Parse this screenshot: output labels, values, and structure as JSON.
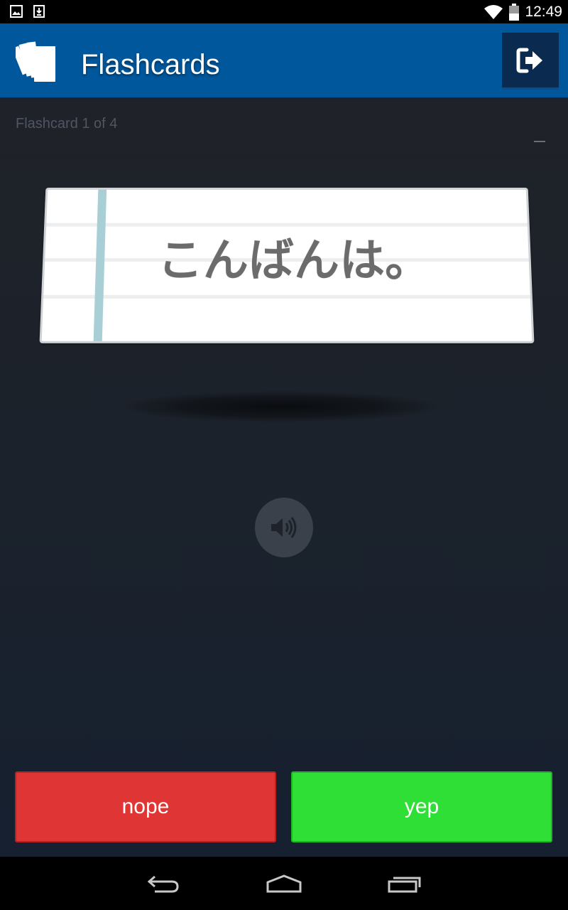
{
  "status_bar": {
    "time": "12:49",
    "icons": [
      "image-icon",
      "download-icon",
      "wifi-icon",
      "battery-icon"
    ]
  },
  "app_bar": {
    "title": "Flashcards",
    "logo_icon": "flashcards-logo-icon",
    "action_icon": "exit-icon",
    "color": "#01579b"
  },
  "flashcard": {
    "counter": "Flashcard 1 of 4",
    "text": "こんばんは。"
  },
  "audio": {
    "icon": "speaker-icon"
  },
  "actions": {
    "nope_label": "nope",
    "yep_label": "yep",
    "nope_color": "#e03535",
    "yep_color": "#2fdf35"
  },
  "nav_bar": {
    "icons": [
      "back-icon",
      "home-icon",
      "recents-icon"
    ]
  }
}
